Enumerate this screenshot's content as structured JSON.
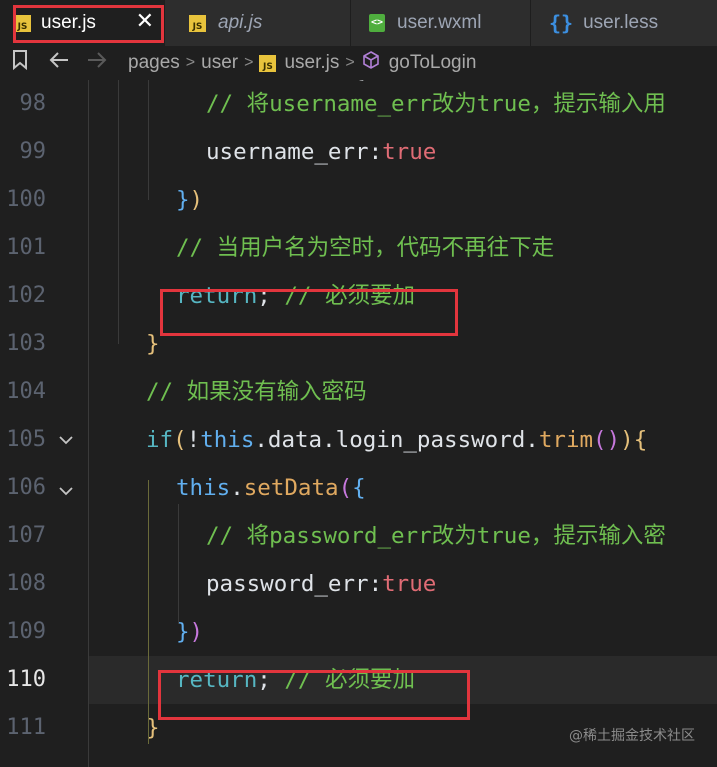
{
  "tabs": [
    {
      "label": "user.js",
      "icon": "js-icon",
      "active": true
    },
    {
      "label": "api.js",
      "icon": "js-icon",
      "active": false
    },
    {
      "label": "user.wxml",
      "icon": "wxml-icon",
      "active": false
    },
    {
      "label": "user.less",
      "icon": "less-icon",
      "active": false
    }
  ],
  "icons": {
    "js": "JS",
    "wxml": "<>",
    "less": "{}"
  },
  "breadcrumb": {
    "items": [
      "pages",
      "user",
      "user.js",
      "goToLogin"
    ]
  },
  "lines": [
    {
      "num": "98",
      "tokens": [
        [
          "c-cm",
          "// 将username_err改为true，提示输入用"
        ]
      ]
    },
    {
      "num": "99",
      "tokens": [
        [
          "c-id",
          "username_err"
        ],
        [
          "c-id",
          ":"
        ],
        [
          "c-bool",
          "true"
        ]
      ]
    },
    {
      "num": "100",
      "tokens": [
        [
          "c-p3",
          "}"
        ],
        [
          "c-p1",
          ")"
        ]
      ]
    },
    {
      "num": "101",
      "tokens": [
        [
          "c-cm",
          "// 当用户名为空时，代码不再往下走"
        ]
      ]
    },
    {
      "num": "102",
      "tokens": [
        [
          "c-kw",
          "return"
        ],
        [
          "c-id",
          "; "
        ],
        [
          "c-cm",
          "// 必须要加"
        ]
      ]
    },
    {
      "num": "103",
      "tokens": [
        [
          "c-p1",
          "}"
        ]
      ]
    },
    {
      "num": "104",
      "tokens": [
        [
          "c-cm",
          "// 如果没有输入密码"
        ]
      ]
    },
    {
      "num": "105",
      "tokens": [
        [
          "c-kw",
          "if"
        ],
        [
          "c-p1",
          "("
        ],
        [
          "c-id",
          "!"
        ],
        [
          "c-this",
          "this"
        ],
        [
          "c-id",
          ".data.login_password."
        ],
        [
          "c-fn",
          "trim"
        ],
        [
          "c-p2",
          "()"
        ],
        [
          "c-p1",
          ")"
        ],
        [
          "c-p1",
          "{"
        ]
      ]
    },
    {
      "num": "106",
      "tokens": [
        [
          "c-this",
          "this"
        ],
        [
          "c-id",
          "."
        ],
        [
          "c-fn",
          "setData"
        ],
        [
          "c-p2",
          "("
        ],
        [
          "c-p3",
          "{"
        ]
      ]
    },
    {
      "num": "107",
      "tokens": [
        [
          "c-cm",
          "// 将password_err改为true，提示输入密"
        ]
      ]
    },
    {
      "num": "108",
      "tokens": [
        [
          "c-id",
          "password_err"
        ],
        [
          "c-id",
          ":"
        ],
        [
          "c-bool",
          "true"
        ]
      ]
    },
    {
      "num": "109",
      "tokens": [
        [
          "c-p3",
          "}"
        ],
        [
          "c-p2",
          ")"
        ]
      ]
    },
    {
      "num": "110",
      "tokens": [
        [
          "c-kw",
          "return"
        ],
        [
          "c-id",
          "; "
        ],
        [
          "c-cm",
          "// 必须要加"
        ]
      ]
    },
    {
      "num": "111",
      "tokens": [
        [
          "c-p1",
          "}"
        ]
      ]
    }
  ],
  "partial_top_line": "this.setData({",
  "current_line": "110",
  "watermark": "@稀土掘金技术社区",
  "colors": {
    "highlight_box": "#e2353d",
    "background": "#1f1f1f"
  }
}
